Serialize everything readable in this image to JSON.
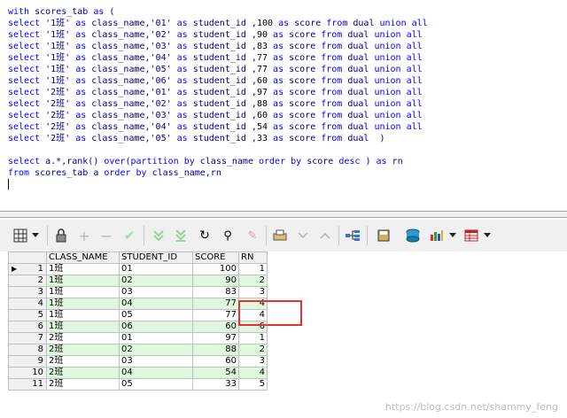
{
  "editor": {
    "lines": [
      [
        {
          "t": "with",
          "c": "kw"
        },
        {
          "t": " scores_tab ",
          "c": "id"
        },
        {
          "t": "as",
          "c": "kw"
        },
        {
          "t": " (",
          "c": "id"
        }
      ],
      [
        {
          "t": "select",
          "c": "kw"
        },
        {
          "t": " '1班' ",
          "c": "str"
        },
        {
          "t": "as",
          "c": "kw"
        },
        {
          "t": " class_name,'01' ",
          "c": "id"
        },
        {
          "t": "as",
          "c": "kw"
        },
        {
          "t": " student_id ,",
          "c": "id"
        },
        {
          "t": "100",
          "c": "num"
        },
        {
          "t": " ",
          "c": "id"
        },
        {
          "t": "as",
          "c": "kw"
        },
        {
          "t": " score ",
          "c": "id"
        },
        {
          "t": "from",
          "c": "kw"
        },
        {
          "t": " dual ",
          "c": "id"
        },
        {
          "t": "union all",
          "c": "kw"
        }
      ],
      [
        {
          "t": "select",
          "c": "kw"
        },
        {
          "t": " '1班' ",
          "c": "str"
        },
        {
          "t": "as",
          "c": "kw"
        },
        {
          "t": " class_name,'02' ",
          "c": "id"
        },
        {
          "t": "as",
          "c": "kw"
        },
        {
          "t": " student_id ,",
          "c": "id"
        },
        {
          "t": "90",
          "c": "num"
        },
        {
          "t": " ",
          "c": "id"
        },
        {
          "t": "as",
          "c": "kw"
        },
        {
          "t": " score ",
          "c": "id"
        },
        {
          "t": "from",
          "c": "kw"
        },
        {
          "t": " dual ",
          "c": "id"
        },
        {
          "t": "union all",
          "c": "kw"
        }
      ],
      [
        {
          "t": "select",
          "c": "kw"
        },
        {
          "t": " '1班' ",
          "c": "str"
        },
        {
          "t": "as",
          "c": "kw"
        },
        {
          "t": " class_name,'03' ",
          "c": "id"
        },
        {
          "t": "as",
          "c": "kw"
        },
        {
          "t": " student_id ,",
          "c": "id"
        },
        {
          "t": "83",
          "c": "num"
        },
        {
          "t": " ",
          "c": "id"
        },
        {
          "t": "as",
          "c": "kw"
        },
        {
          "t": " score ",
          "c": "id"
        },
        {
          "t": "from",
          "c": "kw"
        },
        {
          "t": " dual ",
          "c": "id"
        },
        {
          "t": "union all",
          "c": "kw"
        }
      ],
      [
        {
          "t": "select",
          "c": "kw"
        },
        {
          "t": " '1班' ",
          "c": "str"
        },
        {
          "t": "as",
          "c": "kw"
        },
        {
          "t": " class_name,'04' ",
          "c": "id"
        },
        {
          "t": "as",
          "c": "kw"
        },
        {
          "t": " student_id ,",
          "c": "id"
        },
        {
          "t": "77",
          "c": "num"
        },
        {
          "t": " ",
          "c": "id"
        },
        {
          "t": "as",
          "c": "kw"
        },
        {
          "t": " score ",
          "c": "id"
        },
        {
          "t": "from",
          "c": "kw"
        },
        {
          "t": " dual ",
          "c": "id"
        },
        {
          "t": "union all",
          "c": "kw"
        }
      ],
      [
        {
          "t": "select",
          "c": "kw"
        },
        {
          "t": " '1班' ",
          "c": "str"
        },
        {
          "t": "as",
          "c": "kw"
        },
        {
          "t": " class_name,'05' ",
          "c": "id"
        },
        {
          "t": "as",
          "c": "kw"
        },
        {
          "t": " student_id ,",
          "c": "id"
        },
        {
          "t": "77",
          "c": "num"
        },
        {
          "t": " ",
          "c": "id"
        },
        {
          "t": "as",
          "c": "kw"
        },
        {
          "t": " score ",
          "c": "id"
        },
        {
          "t": "from",
          "c": "kw"
        },
        {
          "t": " dual ",
          "c": "id"
        },
        {
          "t": "union all",
          "c": "kw"
        }
      ],
      [
        {
          "t": "select",
          "c": "kw"
        },
        {
          "t": " '1班' ",
          "c": "str"
        },
        {
          "t": "as",
          "c": "kw"
        },
        {
          "t": " class_name,'06' ",
          "c": "id"
        },
        {
          "t": "as",
          "c": "kw"
        },
        {
          "t": " student_id ,",
          "c": "id"
        },
        {
          "t": "60",
          "c": "num"
        },
        {
          "t": " ",
          "c": "id"
        },
        {
          "t": "as",
          "c": "kw"
        },
        {
          "t": " score ",
          "c": "id"
        },
        {
          "t": "from",
          "c": "kw"
        },
        {
          "t": " dual ",
          "c": "id"
        },
        {
          "t": "union all",
          "c": "kw"
        }
      ],
      [
        {
          "t": "select",
          "c": "kw"
        },
        {
          "t": " '2班' ",
          "c": "str"
        },
        {
          "t": "as",
          "c": "kw"
        },
        {
          "t": " class_name,'01' ",
          "c": "id"
        },
        {
          "t": "as",
          "c": "kw"
        },
        {
          "t": " student_id ,",
          "c": "id"
        },
        {
          "t": "97",
          "c": "num"
        },
        {
          "t": " ",
          "c": "id"
        },
        {
          "t": "as",
          "c": "kw"
        },
        {
          "t": " score ",
          "c": "id"
        },
        {
          "t": "from",
          "c": "kw"
        },
        {
          "t": " dual ",
          "c": "id"
        },
        {
          "t": "union all",
          "c": "kw"
        }
      ],
      [
        {
          "t": "select",
          "c": "kw"
        },
        {
          "t": " '2班' ",
          "c": "str"
        },
        {
          "t": "as",
          "c": "kw"
        },
        {
          "t": " class_name,'02' ",
          "c": "id"
        },
        {
          "t": "as",
          "c": "kw"
        },
        {
          "t": " student_id ,",
          "c": "id"
        },
        {
          "t": "88",
          "c": "num"
        },
        {
          "t": " ",
          "c": "id"
        },
        {
          "t": "as",
          "c": "kw"
        },
        {
          "t": " score ",
          "c": "id"
        },
        {
          "t": "from",
          "c": "kw"
        },
        {
          "t": " dual ",
          "c": "id"
        },
        {
          "t": "union all",
          "c": "kw"
        }
      ],
      [
        {
          "t": "select",
          "c": "kw"
        },
        {
          "t": " '2班' ",
          "c": "str"
        },
        {
          "t": "as",
          "c": "kw"
        },
        {
          "t": " class_name,'03' ",
          "c": "id"
        },
        {
          "t": "as",
          "c": "kw"
        },
        {
          "t": " student_id ,",
          "c": "id"
        },
        {
          "t": "60",
          "c": "num"
        },
        {
          "t": " ",
          "c": "id"
        },
        {
          "t": "as",
          "c": "kw"
        },
        {
          "t": " score ",
          "c": "id"
        },
        {
          "t": "from",
          "c": "kw"
        },
        {
          "t": " dual ",
          "c": "id"
        },
        {
          "t": "union all",
          "c": "kw"
        }
      ],
      [
        {
          "t": "select",
          "c": "kw"
        },
        {
          "t": " '2班' ",
          "c": "str"
        },
        {
          "t": "as",
          "c": "kw"
        },
        {
          "t": " class_name,'04' ",
          "c": "id"
        },
        {
          "t": "as",
          "c": "kw"
        },
        {
          "t": " student_id ,",
          "c": "id"
        },
        {
          "t": "54",
          "c": "num"
        },
        {
          "t": " ",
          "c": "id"
        },
        {
          "t": "as",
          "c": "kw"
        },
        {
          "t": " score ",
          "c": "id"
        },
        {
          "t": "from",
          "c": "kw"
        },
        {
          "t": " dual ",
          "c": "id"
        },
        {
          "t": "union all",
          "c": "kw"
        }
      ],
      [
        {
          "t": "select",
          "c": "kw"
        },
        {
          "t": " '2班' ",
          "c": "str"
        },
        {
          "t": "as",
          "c": "kw"
        },
        {
          "t": " class_name,'05' ",
          "c": "id"
        },
        {
          "t": "as",
          "c": "kw"
        },
        {
          "t": " student_id ,",
          "c": "id"
        },
        {
          "t": "33",
          "c": "num"
        },
        {
          "t": " ",
          "c": "id"
        },
        {
          "t": "as",
          "c": "kw"
        },
        {
          "t": " score ",
          "c": "id"
        },
        {
          "t": "from",
          "c": "kw"
        },
        {
          "t": " dual  )",
          "c": "id"
        }
      ],
      [],
      [
        {
          "t": "select",
          "c": "kw"
        },
        {
          "t": " a.*,rank() ",
          "c": "id"
        },
        {
          "t": "over",
          "c": "kw"
        },
        {
          "t": "(",
          "c": "id"
        },
        {
          "t": "partition by",
          "c": "kw"
        },
        {
          "t": " class_name ",
          "c": "id"
        },
        {
          "t": "order by",
          "c": "kw"
        },
        {
          "t": " score ",
          "c": "id"
        },
        {
          "t": "desc",
          "c": "kw"
        },
        {
          "t": " ) ",
          "c": "id"
        },
        {
          "t": "as",
          "c": "kw"
        },
        {
          "t": " rn",
          "c": "id"
        }
      ],
      [
        {
          "t": "from",
          "c": "kw"
        },
        {
          "t": " scores_tab a ",
          "c": "id"
        },
        {
          "t": "order by",
          "c": "kw"
        },
        {
          "t": " class_name,rn",
          "c": "id"
        }
      ]
    ]
  },
  "toolbar": {
    "icons": [
      "grid-view-icon",
      "dropdown-arrow-icon",
      "lock-icon",
      "add-record-icon",
      "delete-record-icon",
      "post-changes-icon",
      "fetch-next-icon",
      "fetch-last-icon",
      "refresh-icon",
      "query-by-example-icon",
      "clear-record-icon",
      "print-icon",
      "sort-down-icon",
      "sort-up-icon",
      "tree-icon",
      "save-icon",
      "export-icon",
      "chart-icon",
      "chart-dropdown-icon",
      "table-icon",
      "table-dropdown-icon"
    ]
  },
  "grid": {
    "columns": [
      "CLASS_NAME",
      "STUDENT_ID",
      "SCORE",
      "RN"
    ],
    "rows": [
      {
        "n": "1",
        "class": "1班",
        "sid": "01",
        "score": "100",
        "rn": "1"
      },
      {
        "n": "2",
        "class": "1班",
        "sid": "02",
        "score": "90",
        "rn": "2"
      },
      {
        "n": "3",
        "class": "1班",
        "sid": "03",
        "score": "83",
        "rn": "3"
      },
      {
        "n": "4",
        "class": "1班",
        "sid": "04",
        "score": "77",
        "rn": "4"
      },
      {
        "n": "5",
        "class": "1班",
        "sid": "05",
        "score": "77",
        "rn": "4"
      },
      {
        "n": "6",
        "class": "1班",
        "sid": "06",
        "score": "60",
        "rn": "6"
      },
      {
        "n": "7",
        "class": "2班",
        "sid": "01",
        "score": "97",
        "rn": "1"
      },
      {
        "n": "8",
        "class": "2班",
        "sid": "02",
        "score": "88",
        "rn": "2"
      },
      {
        "n": "9",
        "class": "2班",
        "sid": "03",
        "score": "60",
        "rn": "3"
      },
      {
        "n": "10",
        "class": "2班",
        "sid": "04",
        "score": "54",
        "rn": "4"
      },
      {
        "n": "11",
        "class": "2班",
        "sid": "05",
        "score": "33",
        "rn": "5"
      }
    ]
  },
  "watermark": "https://blog.csdn.net/shammy_feng",
  "colors": {
    "keyword": "#0000ff",
    "identifier": "#000080",
    "alt_row": "#dff7df",
    "highlight": "#e8312f"
  }
}
